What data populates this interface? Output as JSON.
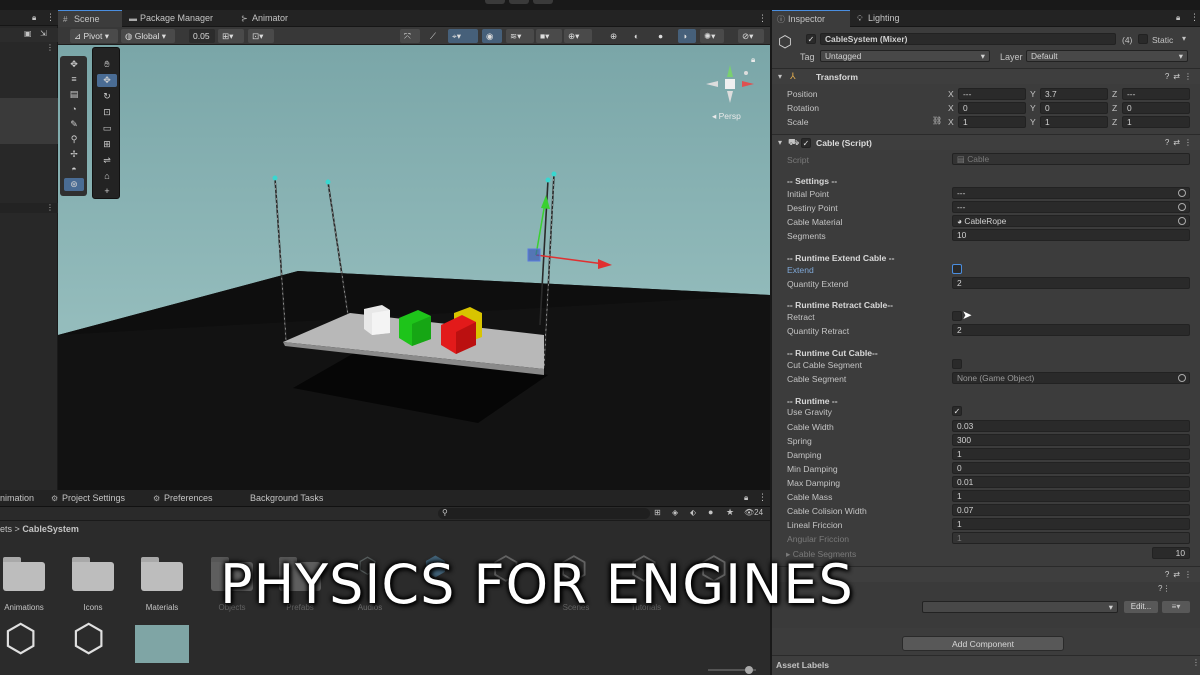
{
  "scene_tabs": [
    {
      "label": "Scene",
      "icon": "grid-icon"
    },
    {
      "label": "Package Manager",
      "icon": "package-icon"
    },
    {
      "label": "Animator",
      "icon": "animator-icon"
    }
  ],
  "toolbar": {
    "pivot": "Pivot",
    "global": "Global",
    "snap_value": "0.05"
  },
  "gizmo": {
    "persp": "Persp"
  },
  "bottom_tabs": [
    {
      "label": "nimation"
    },
    {
      "label": "Project Settings"
    },
    {
      "label": "Preferences"
    },
    {
      "label": "Background Tasks"
    }
  ],
  "breadcrumb": {
    "parent": "ets",
    "separator": ">",
    "current": "CableSystem"
  },
  "project": {
    "count": "24",
    "assets": [
      "Animations",
      "Icons",
      "Materials",
      "Objects",
      "Prefabs",
      "Audios",
      "Scenes",
      "Tutorials",
      "Settings"
    ]
  },
  "inspector": {
    "tabs": [
      {
        "label": "Inspector"
      },
      {
        "label": "Lighting"
      }
    ],
    "object_name": "CableSystem (Mixer)",
    "children_count": "(4)",
    "static_label": "Static",
    "tag_label": "Tag",
    "tag_value": "Untagged",
    "layer_label": "Layer",
    "layer_value": "Default",
    "transform": {
      "title": "Transform",
      "position": {
        "label": "Position",
        "x": "---",
        "y": "3.7",
        "z": "---"
      },
      "rotation": {
        "label": "Rotation",
        "x": "0",
        "y": "0",
        "z": "0"
      },
      "scale": {
        "label": "Scale",
        "x": "1",
        "y": "1",
        "z": "1"
      }
    },
    "cable": {
      "title": "Cable (Script)",
      "script_label": "Script",
      "script_value": "Cable",
      "settings_hdr": "-- Settings --",
      "initial_point": {
        "label": "Initial Point",
        "value": "---"
      },
      "destiny_point": {
        "label": "Destiny Point",
        "value": "---"
      },
      "cable_material": {
        "label": "Cable Material",
        "value": "CableRope"
      },
      "segments": {
        "label": "Segments",
        "value": "10"
      },
      "extend_hdr": "-- Runtime Extend Cable --",
      "extend": {
        "label": "Extend",
        "checked": false
      },
      "quantity_extend": {
        "label": "Quantity Extend",
        "value": "2"
      },
      "retract_hdr": "-- Runtime Retract Cable--",
      "retract": {
        "label": "Retract",
        "checked": false
      },
      "quantity_retract": {
        "label": "Quantity Retract",
        "value": "2"
      },
      "cut_hdr": "-- Runtime Cut Cable--",
      "cut_segment": {
        "label": "Cut Cable Segment",
        "checked": false
      },
      "cable_segment": {
        "label": "Cable Segment",
        "value": "None (Game Object)"
      },
      "runtime_hdr": "-- Runtime --",
      "use_gravity": {
        "label": "Use Gravity",
        "checked": true
      },
      "cable_width": {
        "label": "Cable Width",
        "value": "0.03"
      },
      "spring": {
        "label": "Spring",
        "value": "300"
      },
      "damping": {
        "label": "Damping",
        "value": "1"
      },
      "min_damping": {
        "label": "Min Damping",
        "value": "0"
      },
      "max_damping": {
        "label": "Max Damping",
        "value": "0.01"
      },
      "cable_mass": {
        "label": "Cable Mass",
        "value": "1"
      },
      "cable_collision_width": {
        "label": "Cable Colision Width",
        "value": "0.07"
      },
      "lineal_friccion": {
        "label": "Lineal Friccion",
        "value": "1"
      },
      "angular_friccion": {
        "label": "Angular Friccion",
        "value": "1"
      },
      "cable_segments": {
        "label": "Cable Segments",
        "value": "10"
      }
    },
    "edit_btn": "Edit...",
    "add_component": "Add Component",
    "asset_labels": "Asset Labels"
  },
  "overlay_title": "PHYSICS FOR ENGINES",
  "colors": {
    "sky": "#8fb8b8",
    "ground": "#101010",
    "accent": "#4a8ee0"
  }
}
